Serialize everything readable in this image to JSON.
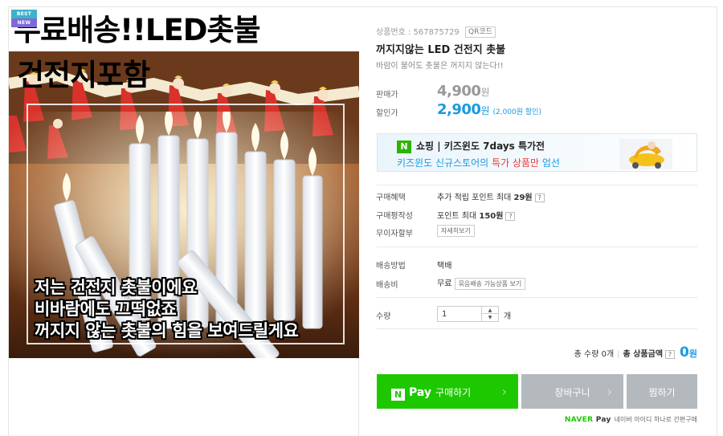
{
  "image": {
    "badges": [
      "BEST",
      "NEW"
    ],
    "headline_1": "무료배송!!LED촛불",
    "headline_2": "건전지포함",
    "overlay_lines": [
      "저는 건전지 촛불이에요",
      "비바람에도 끄떡없죠",
      "꺼지지 않는 촛불의 힘을 보여드릴게요"
    ]
  },
  "product": {
    "code_label": "상품번호 : 567875729",
    "qr_label": "QR코드",
    "title": "꺼지지않는 LED 건전지 촛불",
    "subtitle": "바람이 불어도 촛불은 꺼지지 않는다!!"
  },
  "price": {
    "original_label": "판매가",
    "original_value": "4,900",
    "sale_label": "할인가",
    "sale_value": "2,900",
    "unit": "원",
    "discount_note": "(2,000원 할인)"
  },
  "banner": {
    "n_letter": "N",
    "line1": "쇼핑 | 키즈윈도 7days 특가전",
    "line2_a": "키즈윈도 신규스토어의 ",
    "line2_b": "특가 상품만",
    "line2_c": " 엄선"
  },
  "benefits": {
    "purchase_label": "구매혜택",
    "purchase_value_a": "추가 적립 포인트 최대 ",
    "purchase_value_b": "29원",
    "review_label": "구매평작성",
    "review_value_a": "포인트 최대 ",
    "review_value_b": "150원",
    "installment_label": "무이자할부",
    "installment_button": "자세히보기",
    "question_mark": "?"
  },
  "shipping": {
    "method_label": "배송방법",
    "method_value": "택배",
    "fee_label": "배송비",
    "fee_value": "무료",
    "bundle_button": "묶음배송 가능상품 보기"
  },
  "quantity": {
    "label": "수량",
    "value": "1",
    "unit": "개",
    "up": "▲",
    "down": "▼"
  },
  "total": {
    "qty_text": "총 수량 0개",
    "label": "총 상품금액",
    "value": "0",
    "unit": "원"
  },
  "buttons": {
    "pay_n": "N",
    "pay_word": "Pay",
    "pay_label": "구매하기",
    "cart_label": "장바구니",
    "wish_label": "찜하기",
    "chevron": "›"
  },
  "naverpay": {
    "brand_a": "NAVER",
    "brand_b": "Pay",
    "text": "네이버 아이디 하나로 간편구매"
  },
  "colors": {
    "accent_blue": "#1a9ae0",
    "pay_green": "#1ec800",
    "gray_button": "#b4b9be"
  }
}
